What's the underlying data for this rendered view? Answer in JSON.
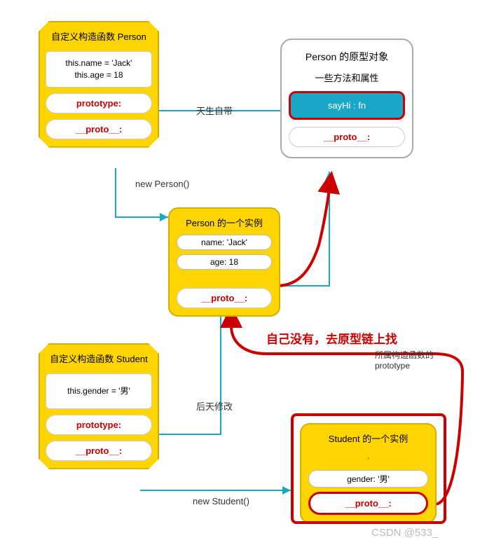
{
  "personBox": {
    "title": "自定义构造函数 Person",
    "body": "this.name = 'Jack'\nthis.age = 18",
    "prototype": "prototype:",
    "proto": "__proto__:"
  },
  "personProtoObj": {
    "title": "Person  的原型对象",
    "sub": "一些方法和属性",
    "method": "sayHi : fn",
    "proto": "__proto__:"
  },
  "personInstance": {
    "title": "Person 的一个实例",
    "row1": "name: 'Jack'",
    "row2": "age: 18",
    "proto": "__proto__:"
  },
  "studentBox": {
    "title": "自定义构造函数 Student",
    "body": "this.gender = '男'",
    "prototype": "prototype:",
    "proto": "__proto__:"
  },
  "studentInstance": {
    "title": "Student 的一个实例",
    "row1": "gender: '男'",
    "proto": "__proto__:"
  },
  "labels": {
    "born": "天生自带",
    "newPerson": "new Person()",
    "later": "后天修改",
    "newStudent": "new Student()",
    "constructorProto": "所属构造函数的\nprototype",
    "redNote": "自己没有，去原型链上找"
  },
  "watermark": "CSDN @533_"
}
